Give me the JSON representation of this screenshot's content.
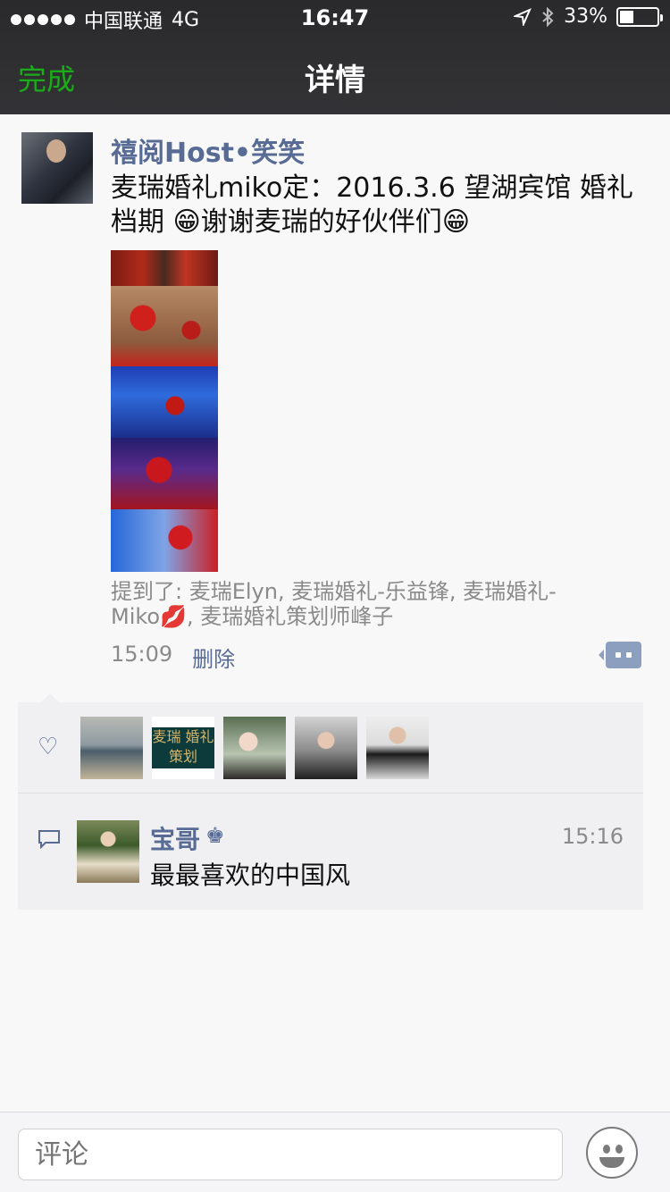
{
  "status": {
    "carrier": "中国联通",
    "network": "4G",
    "time": "16:47",
    "battery": "33%"
  },
  "nav": {
    "done": "完成",
    "title": "详情"
  },
  "post": {
    "author": "禧阅Host•笑笑",
    "content": "麦瑞婚礼miko定：2016.3.6 望湖宾馆 婚礼档期 😁谢谢麦瑞的好伙伴们😁",
    "mention": "提到了: 麦瑞Elyn, 麦瑞婚礼-乐益锋, 麦瑞婚礼-Miko💋, 麦瑞婚礼策划师峰子",
    "time": "15:09",
    "delete": "删除",
    "likes_logo_text": "麦瑞 婚礼策划"
  },
  "comment": {
    "name": "宝哥",
    "badge": "♚",
    "time": "15:16",
    "text": "最最喜欢的中国风"
  },
  "input": {
    "placeholder": "评论"
  }
}
